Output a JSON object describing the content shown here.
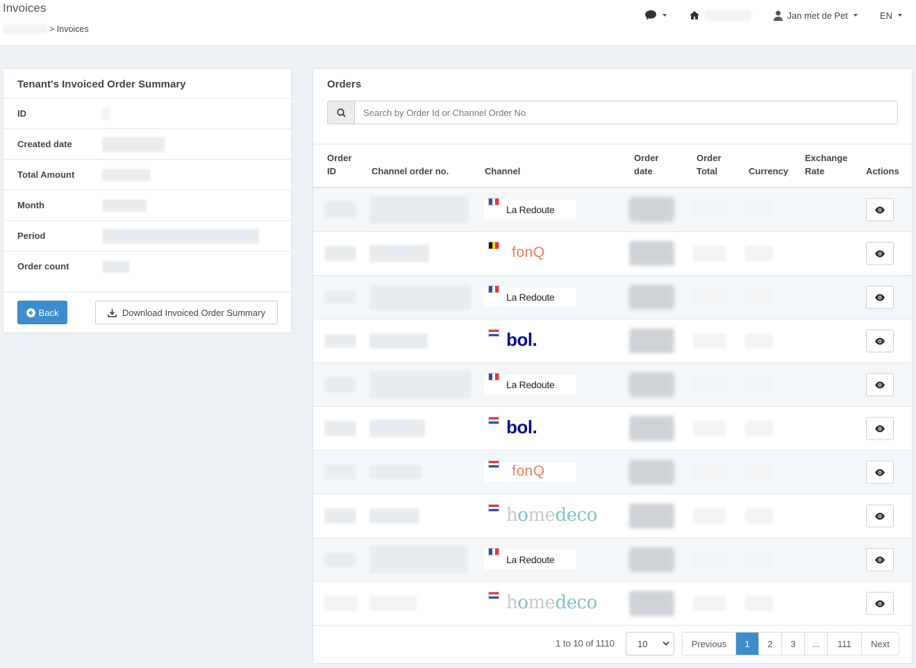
{
  "header": {
    "title": "Invoices",
    "breadcrumb_current": "> Invoices",
    "user_name": "Jan met de Pet",
    "language": "EN"
  },
  "summary": {
    "title": "Tenant's Invoiced Order Summary",
    "rows": [
      {
        "label": "ID"
      },
      {
        "label": "Created date"
      },
      {
        "label": "Total Amount"
      },
      {
        "label": "Month"
      },
      {
        "label": "Period"
      },
      {
        "label": "Order count"
      }
    ],
    "back_label": "Back",
    "download_label": "Download Invoiced Order Summary"
  },
  "orders": {
    "title": "Orders",
    "search_placeholder": "Search by Order Id or Channel Order No",
    "columns": {
      "order_id_1": "Order",
      "order_id_2": "ID",
      "channel_order_no": "Channel order no.",
      "channel": "Channel",
      "order_date_1": "Order",
      "order_date_2": "date",
      "order_total_1": "Order",
      "order_total_2": "Total",
      "currency": "Currency",
      "exchange_rate_1": "Exchange",
      "exchange_rate_2": "Rate",
      "actions": "Actions"
    },
    "rows": [
      {
        "channel": "La Redoute",
        "flag": "fr"
      },
      {
        "channel": "fonQ",
        "flag": "be"
      },
      {
        "channel": "La Redoute",
        "flag": "fr"
      },
      {
        "channel": "bol.",
        "flag": "nl"
      },
      {
        "channel": "La Redoute",
        "flag": "fr"
      },
      {
        "channel": "bol.",
        "flag": "nl"
      },
      {
        "channel": "fonQ",
        "flag": "nl"
      },
      {
        "channel": "homedeco",
        "flag": "nl"
      },
      {
        "channel": "La Redoute",
        "flag": "fr"
      },
      {
        "channel": "homedeco",
        "flag": "nl"
      }
    ]
  },
  "pagination": {
    "info": "1 to 10 of 1110",
    "page_size": "10",
    "previous": "Previous",
    "pages": [
      "1",
      "2",
      "3",
      "...",
      "111"
    ],
    "next": "Next",
    "active_page": "1"
  },
  "colors": {
    "primary": "#3c8dcd",
    "fonq": "#ef7b5c",
    "bol": "#0a0e8b",
    "homedeco_accent": "#7cc5c4"
  }
}
